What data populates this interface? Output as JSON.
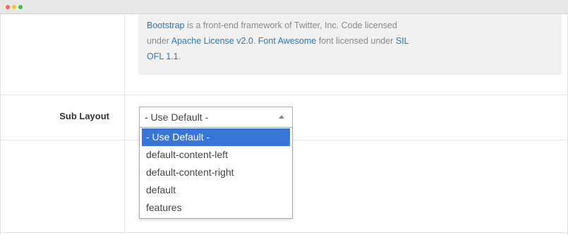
{
  "window": {
    "controls": [
      "close",
      "minimize",
      "maximize"
    ]
  },
  "notice": {
    "bootstrap_link": "Bootstrap",
    "text_1": " is a front-end framework of Twitter, Inc. Code licensed",
    "text_2": "under ",
    "apache_link": "Apache License v2.0",
    "text_3": ". ",
    "fontawesome_link": "Font Awesome",
    "text_4": " font licensed under ",
    "sil_link": "SIL",
    "ofl_link": "OFL 1.1",
    "text_5": "."
  },
  "sub_layout": {
    "label": "Sub Layout",
    "selected_value": "- Use Default -",
    "options": [
      "- Use Default -",
      "default-content-left",
      "default-content-right",
      "default",
      "features"
    ]
  },
  "colors": {
    "link": "#2a7ab8",
    "highlight": "#3875d7",
    "notice_bg": "#f1f1f1"
  }
}
